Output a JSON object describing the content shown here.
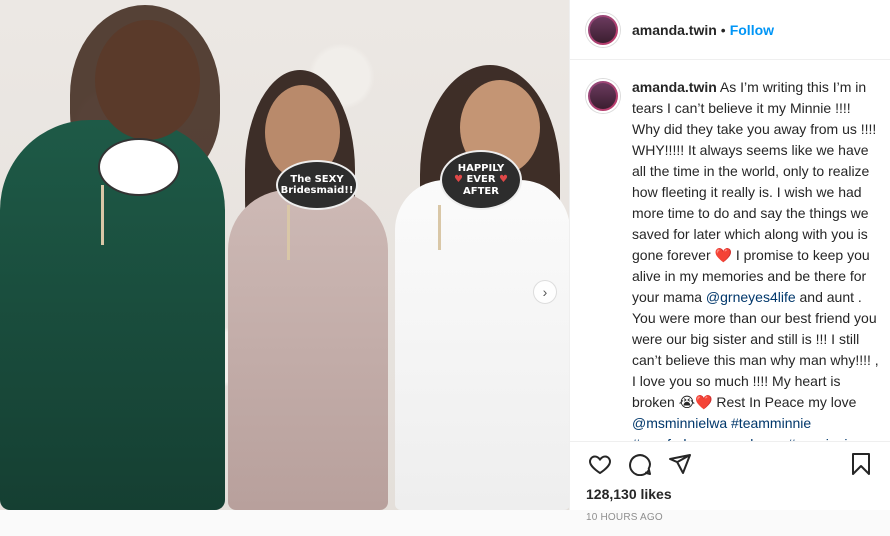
{
  "post": {
    "username": "amanda.twin",
    "dot": "•",
    "follow_label": "Follow",
    "photo": {
      "sign_left": "The SEXY Bridesmaid!!",
      "sign_right_line1": "HAPPILY",
      "sign_right_line2": "EVER",
      "sign_right_line3": "AFTER",
      "carousel_next_icon": "chevron-right-icon"
    },
    "caption": {
      "username": "amanda.twin",
      "part1": "As I’m writing this I’m in tears I can’t believe it my Minnie !!!! Why did they take you away from us !!!! WHY!!!!! It always seems like we have all the time in the world, only to realize how fleeting it really is. I wish we had more time to do and say the things we saved for later which along with you is gone forever",
      "part2": "I promise to keep you alive in my memories and be there for your mama",
      "mention1": "@grneyes4life",
      "part3": "and aunt . You were more than our best friend you were our big sister and still is !!! I still can’t believe this man why man why!!!! , I love you so much !!!! My heart is broken",
      "part4": "Rest In Peace my love",
      "mention2": "@msminnielwa",
      "hashtags": "#teamminnie #prayforhermamaplease #myminnie #bestfriends #sisters #reallifeisfood #lovethatlove",
      "emoji_heart": "❤️",
      "emoji_cry": "😭"
    },
    "likes": "128,130 likes",
    "time": "10 HOURS AGO"
  },
  "icons": {
    "like": "heart-icon",
    "comment": "comment-icon",
    "share": "share-icon",
    "save": "bookmark-icon"
  },
  "colors": {
    "link": "#0095f6",
    "mention": "#00376b",
    "heart": "#c8102e"
  }
}
